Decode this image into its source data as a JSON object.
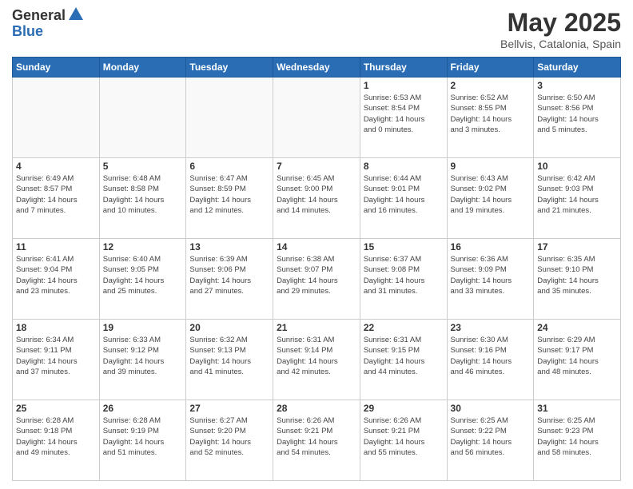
{
  "header": {
    "logo_line1": "General",
    "logo_line2": "Blue",
    "month": "May 2025",
    "location": "Bellvis, Catalonia, Spain"
  },
  "weekdays": [
    "Sunday",
    "Monday",
    "Tuesday",
    "Wednesday",
    "Thursday",
    "Friday",
    "Saturday"
  ],
  "weeks": [
    [
      {
        "day": "",
        "info": ""
      },
      {
        "day": "",
        "info": ""
      },
      {
        "day": "",
        "info": ""
      },
      {
        "day": "",
        "info": ""
      },
      {
        "day": "1",
        "info": "Sunrise: 6:53 AM\nSunset: 8:54 PM\nDaylight: 14 hours\nand 0 minutes."
      },
      {
        "day": "2",
        "info": "Sunrise: 6:52 AM\nSunset: 8:55 PM\nDaylight: 14 hours\nand 3 minutes."
      },
      {
        "day": "3",
        "info": "Sunrise: 6:50 AM\nSunset: 8:56 PM\nDaylight: 14 hours\nand 5 minutes."
      }
    ],
    [
      {
        "day": "4",
        "info": "Sunrise: 6:49 AM\nSunset: 8:57 PM\nDaylight: 14 hours\nand 7 minutes."
      },
      {
        "day": "5",
        "info": "Sunrise: 6:48 AM\nSunset: 8:58 PM\nDaylight: 14 hours\nand 10 minutes."
      },
      {
        "day": "6",
        "info": "Sunrise: 6:47 AM\nSunset: 8:59 PM\nDaylight: 14 hours\nand 12 minutes."
      },
      {
        "day": "7",
        "info": "Sunrise: 6:45 AM\nSunset: 9:00 PM\nDaylight: 14 hours\nand 14 minutes."
      },
      {
        "day": "8",
        "info": "Sunrise: 6:44 AM\nSunset: 9:01 PM\nDaylight: 14 hours\nand 16 minutes."
      },
      {
        "day": "9",
        "info": "Sunrise: 6:43 AM\nSunset: 9:02 PM\nDaylight: 14 hours\nand 19 minutes."
      },
      {
        "day": "10",
        "info": "Sunrise: 6:42 AM\nSunset: 9:03 PM\nDaylight: 14 hours\nand 21 minutes."
      }
    ],
    [
      {
        "day": "11",
        "info": "Sunrise: 6:41 AM\nSunset: 9:04 PM\nDaylight: 14 hours\nand 23 minutes."
      },
      {
        "day": "12",
        "info": "Sunrise: 6:40 AM\nSunset: 9:05 PM\nDaylight: 14 hours\nand 25 minutes."
      },
      {
        "day": "13",
        "info": "Sunrise: 6:39 AM\nSunset: 9:06 PM\nDaylight: 14 hours\nand 27 minutes."
      },
      {
        "day": "14",
        "info": "Sunrise: 6:38 AM\nSunset: 9:07 PM\nDaylight: 14 hours\nand 29 minutes."
      },
      {
        "day": "15",
        "info": "Sunrise: 6:37 AM\nSunset: 9:08 PM\nDaylight: 14 hours\nand 31 minutes."
      },
      {
        "day": "16",
        "info": "Sunrise: 6:36 AM\nSunset: 9:09 PM\nDaylight: 14 hours\nand 33 minutes."
      },
      {
        "day": "17",
        "info": "Sunrise: 6:35 AM\nSunset: 9:10 PM\nDaylight: 14 hours\nand 35 minutes."
      }
    ],
    [
      {
        "day": "18",
        "info": "Sunrise: 6:34 AM\nSunset: 9:11 PM\nDaylight: 14 hours\nand 37 minutes."
      },
      {
        "day": "19",
        "info": "Sunrise: 6:33 AM\nSunset: 9:12 PM\nDaylight: 14 hours\nand 39 minutes."
      },
      {
        "day": "20",
        "info": "Sunrise: 6:32 AM\nSunset: 9:13 PM\nDaylight: 14 hours\nand 41 minutes."
      },
      {
        "day": "21",
        "info": "Sunrise: 6:31 AM\nSunset: 9:14 PM\nDaylight: 14 hours\nand 42 minutes."
      },
      {
        "day": "22",
        "info": "Sunrise: 6:31 AM\nSunset: 9:15 PM\nDaylight: 14 hours\nand 44 minutes."
      },
      {
        "day": "23",
        "info": "Sunrise: 6:30 AM\nSunset: 9:16 PM\nDaylight: 14 hours\nand 46 minutes."
      },
      {
        "day": "24",
        "info": "Sunrise: 6:29 AM\nSunset: 9:17 PM\nDaylight: 14 hours\nand 48 minutes."
      }
    ],
    [
      {
        "day": "25",
        "info": "Sunrise: 6:28 AM\nSunset: 9:18 PM\nDaylight: 14 hours\nand 49 minutes."
      },
      {
        "day": "26",
        "info": "Sunrise: 6:28 AM\nSunset: 9:19 PM\nDaylight: 14 hours\nand 51 minutes."
      },
      {
        "day": "27",
        "info": "Sunrise: 6:27 AM\nSunset: 9:20 PM\nDaylight: 14 hours\nand 52 minutes."
      },
      {
        "day": "28",
        "info": "Sunrise: 6:26 AM\nSunset: 9:21 PM\nDaylight: 14 hours\nand 54 minutes."
      },
      {
        "day": "29",
        "info": "Sunrise: 6:26 AM\nSunset: 9:21 PM\nDaylight: 14 hours\nand 55 minutes."
      },
      {
        "day": "30",
        "info": "Sunrise: 6:25 AM\nSunset: 9:22 PM\nDaylight: 14 hours\nand 56 minutes."
      },
      {
        "day": "31",
        "info": "Sunrise: 6:25 AM\nSunset: 9:23 PM\nDaylight: 14 hours\nand 58 minutes."
      }
    ]
  ]
}
